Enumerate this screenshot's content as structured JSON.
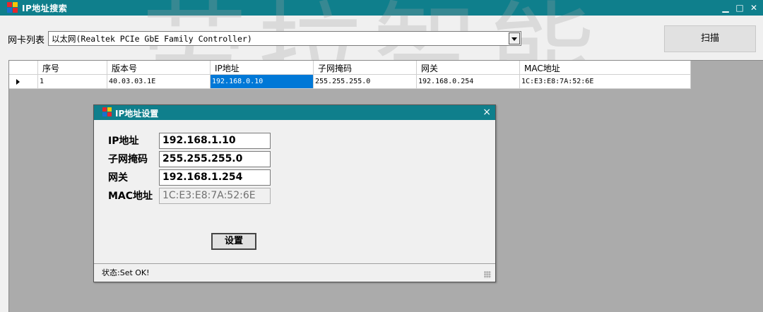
{
  "main_window": {
    "title": "IP地址搜索",
    "controls": {
      "minimize": "▁",
      "maximize": "□",
      "close": "✕"
    }
  },
  "watermark": "劳拉智能",
  "nic": {
    "label": "网卡列表",
    "selected": "以太网(Realtek PCIe GbE Family Controller)"
  },
  "scan_button": "扫描",
  "grid": {
    "columns": [
      "序号",
      "版本号",
      "IP地址",
      "子网掩码",
      "网关",
      "MAC地址"
    ],
    "rows": [
      {
        "index": "1",
        "version": "40.03.03.1E",
        "ip": "192.168.0.10",
        "mask": "255.255.255.0",
        "gateway": "192.168.0.254",
        "mac": "1C:E3:E8:7A:52:6E"
      }
    ]
  },
  "dialog": {
    "title": "IP地址设置",
    "close": "×",
    "ip_label": "IP地址",
    "ip_value": "192.168.1.10",
    "mask_label": "子网掩码",
    "mask_value": "255.255.255.0",
    "gateway_label": "网关",
    "gateway_value": "192.168.1.254",
    "mac_label": "MAC地址",
    "mac_value": "1C:E3:E8:7A:52:6E",
    "set_button": "设置",
    "status": "状态:Set OK!"
  },
  "colors": {
    "titlebar": "#0f7f8c",
    "selection": "#0078d7",
    "grid_background": "#ababab"
  },
  "icons": [
    "app-logo-icon",
    "minimize-icon",
    "maximize-icon",
    "close-icon",
    "dropdown-arrow-icon",
    "row-pointer-icon",
    "resize-grip-icon"
  ]
}
